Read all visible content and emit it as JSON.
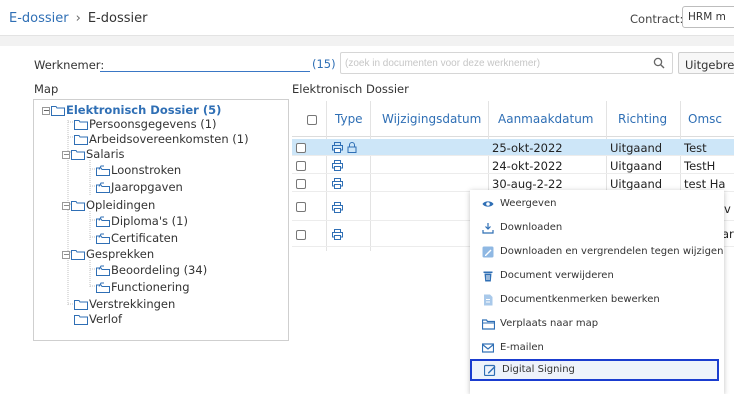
{
  "breadcrumb": {
    "root": "E-dossier",
    "separator": "›",
    "current": "E-dossier"
  },
  "contract": {
    "label": "Contract:",
    "value": "HRM m"
  },
  "werknemer": {
    "label": "Werknemer:",
    "count": "(15)"
  },
  "search": {
    "placeholder": "(zoek in documenten voor deze werknemer)"
  },
  "buttons": {
    "uitgebreid": "Uitgebre"
  },
  "map_header": "Map",
  "dossier_header": "Elektronisch Dossier",
  "tree": {
    "root": "Elektronisch Dossier (5)",
    "items": [
      "Persoonsgegevens (1)",
      "Arbeidsovereenkomsten (1)",
      "Salaris",
      "Loonstroken",
      "Jaaropgaven",
      "Opleidingen",
      "Diploma's (1)",
      "Certificaten",
      "Gesprekken",
      "Beoordeling (34)",
      "Functionering",
      "Verstrekkingen",
      "Verlof"
    ]
  },
  "grid": {
    "columns": [
      "Type",
      "Wijzigingsdatum",
      "Aanmaakdatum",
      "Richting",
      "Omsc"
    ],
    "rows": [
      {
        "aanmaak": "25-okt-2022",
        "richting": "Uitgaand",
        "omschrijving": "Test"
      },
      {
        "aanmaak": "24-okt-2022",
        "richting": "Uitgaand",
        "omschrijving": "TestH"
      },
      {
        "aanmaak": "30-aug-2-22",
        "richting": "Uitgaand",
        "omschrijving": "test Ha"
      }
    ],
    "extra": [
      "v",
      "ar"
    ]
  },
  "context_menu": [
    {
      "label": "Weergeven",
      "icon": "eye-icon"
    },
    {
      "label": "Downloaden",
      "icon": "download-icon"
    },
    {
      "label": "Downloaden en vergrendelen tegen wijzigen",
      "icon": "download-lock-icon"
    },
    {
      "label": "Document verwijderen",
      "icon": "trash-icon"
    },
    {
      "label": "Documentkenmerken bewerken",
      "icon": "document-edit-icon"
    },
    {
      "label": "Verplaats naar map",
      "icon": "folder-move-icon"
    },
    {
      "label": "E-mailen",
      "icon": "mail-icon"
    },
    {
      "label": "Digital Signing",
      "icon": "sign-icon"
    }
  ],
  "colors": {
    "link": "#2f6fb5",
    "selection": "#cde6f8",
    "highlight_border": "#1a3ccf"
  }
}
